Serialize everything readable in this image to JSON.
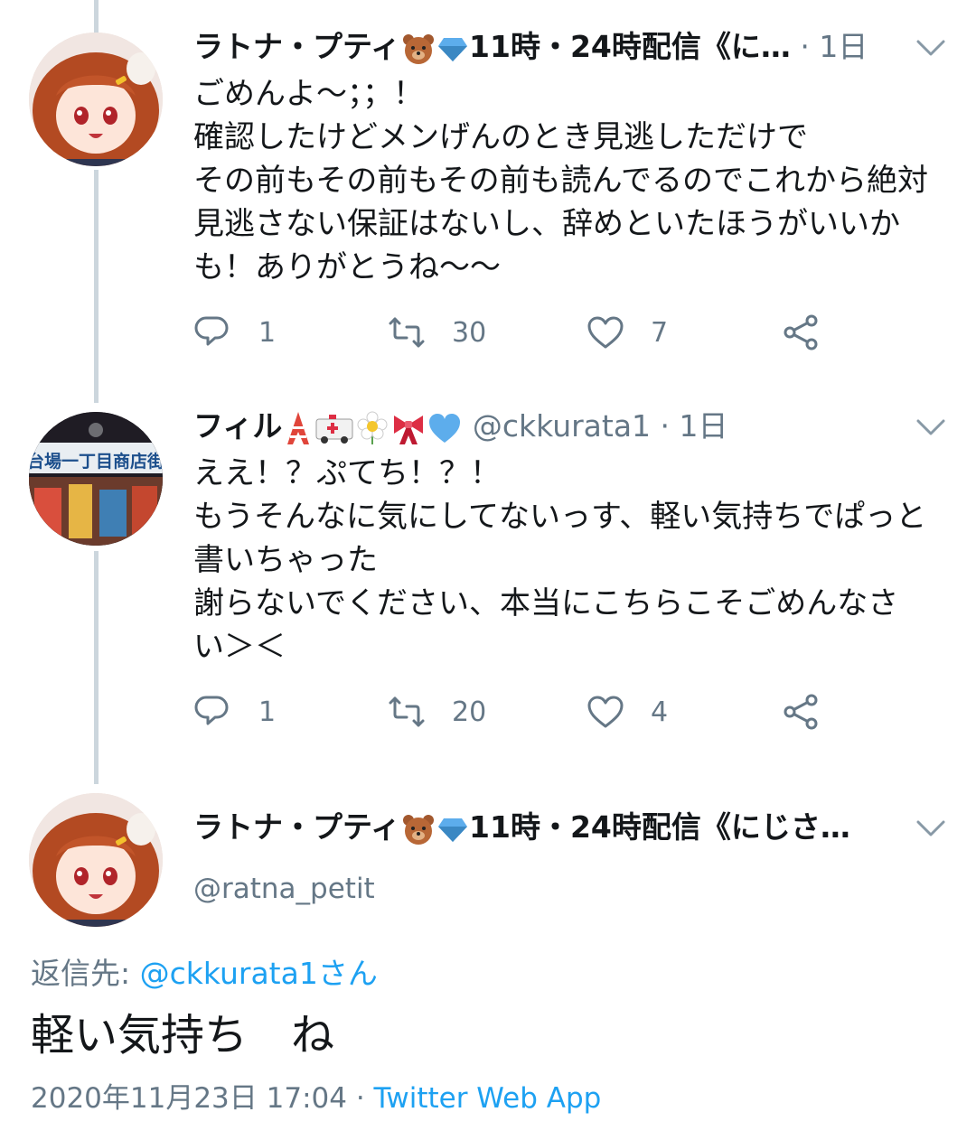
{
  "tweets": [
    {
      "name": "ラトナ・プティ",
      "name_suffix": "11時・24時配信《に…",
      "meta": " · 1日",
      "text": "ごめんよ～；；！\n確認したけどメンげんのとき見逃しただけで\nその前もその前もその前も読んでるのでこれから絶対\n見逃さない保証はないし、辞めといたほうがいいか\nも！ありがとうね～～",
      "replies": "1",
      "retweets": "30",
      "likes": "7"
    },
    {
      "name": "フィル",
      "handle": "@ckkurata1",
      "meta": " · 1日",
      "text": "ええ！？ぷてち！？！\nもうそんなに気にしてないっす、軽い気持ちでぱっと\n書いちゃった\n謝らないでください、本当にこちらこそごめんなさ\nい＞＜",
      "replies": "1",
      "retweets": "20",
      "likes": "4",
      "avatar_sign": "台場一丁目商店街"
    }
  ],
  "main_tweet": {
    "name": "ラトナ・プティ",
    "name_suffix": "11時・24時配信《にじさ…",
    "handle": "@ratna_petit",
    "reply_label": "返信先: ",
    "reply_to": "@ckkurata1さん",
    "text": "軽い気持ち　ね",
    "timestamp": "2020年11月23日 17:04 · ",
    "source": "Twitter Web App"
  },
  "colors": {
    "accent": "#1da1f2",
    "muted": "#657786",
    "thread": "#ccd6dd"
  }
}
